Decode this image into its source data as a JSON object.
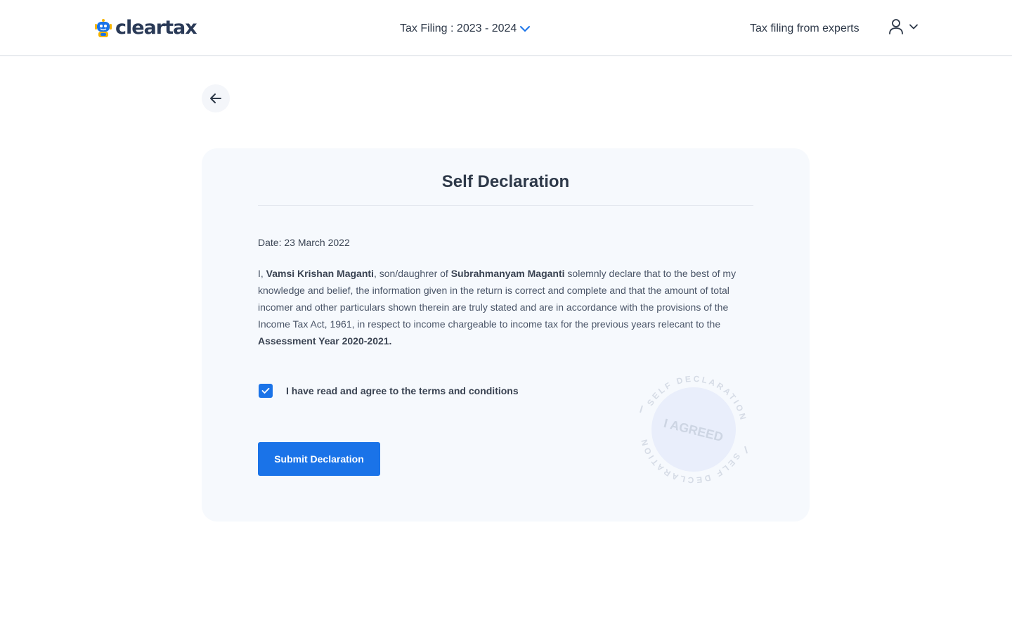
{
  "brand": {
    "name": "cleartax",
    "primary_color": "#1a73e8",
    "text_color": "#2d3848"
  },
  "header": {
    "year_selector": {
      "label": "Tax Filing : 2023 - 2024",
      "icon": "chevron-down-icon"
    },
    "experts_link": "Tax filing from experts",
    "user_menu": {
      "icon": "user-icon",
      "chevron": "chevron-down-icon"
    }
  },
  "back_button": {
    "icon": "arrow-left-icon"
  },
  "card": {
    "title": "Self Declaration",
    "date": "Date: 23 March 2022",
    "declaration": {
      "prefix": "I, ",
      "name": "Vamsi Krishan Maganti",
      "relation": ", son/daughrer of ",
      "parent_name": "Subrahmanyam Maganti",
      "body": " solemnly declare that to the best of my knowledge and belief, the information given in the return is correct and complete and that the amount of total incomer and other particulars shown therein are truly stated and are in accordance with the provisions of the Income Tax Act, 1961, in respect to income chargeable to income tax for the previous years relecant to the ",
      "assessment_year": "Assessment Year 2020-2021."
    },
    "agree": {
      "checked": true,
      "label": "I have read and agree to the terms and conditions"
    },
    "submit_label": "Submit Declaration",
    "stamp": {
      "ring_text_top": "SELF DECLARATION",
      "ring_text_bottom": "SELF DECLARATION",
      "center_text": "I AGREED"
    }
  }
}
